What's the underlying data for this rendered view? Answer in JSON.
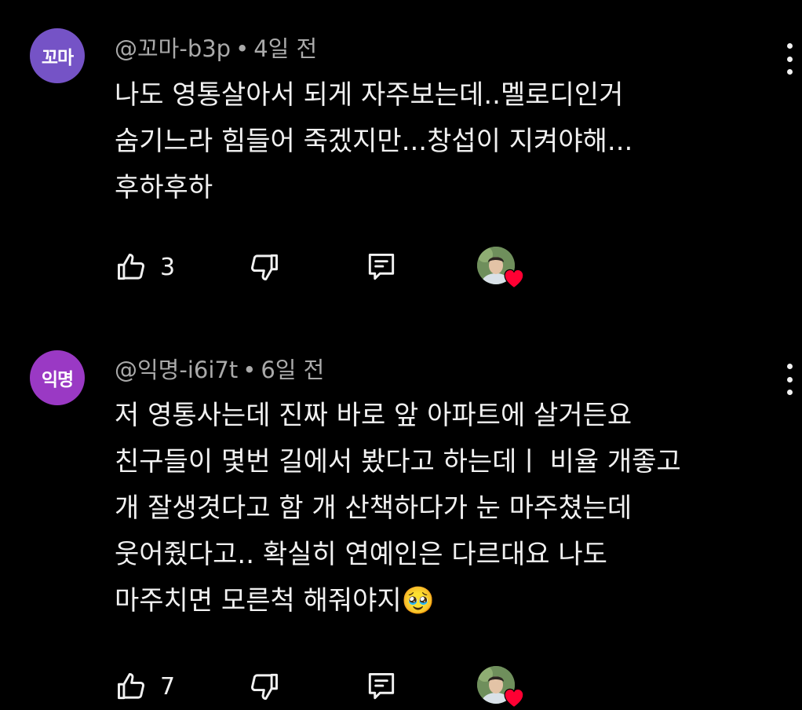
{
  "colors": {
    "background": "#000000",
    "text": "#f1f1f1",
    "meta": "#aaaaaa",
    "avatar1": "#7553c6",
    "avatar2": "#9a39c4",
    "heart": "#ff0033"
  },
  "comments": [
    {
      "avatar_text": "꼬마",
      "handle": "@꼬마-b3p",
      "separator": "•",
      "time": "4일 전",
      "lines": [
        "나도 영통살아서 되게 자주보는데..멜로디인거",
        "숨기느라 힘들어 죽겠지만...창섭이 지켜야해...",
        "후하후하"
      ],
      "like_count": "3",
      "icons": [
        "like-icon",
        "dislike-icon",
        "reply-icon",
        "creator-heart-icon",
        "more-options-icon"
      ]
    },
    {
      "avatar_text": "익명",
      "handle": "@익명-i6i7t",
      "separator": "•",
      "time": "6일 전",
      "lines": [
        "저 영통사는데 진짜 바로 앞 아파트에 살거든요",
        "친구들이 몇번 길에서 봤다고 하는데ㅣ 비율 개좋고",
        "개 잘생겻다고 함 개 산책하다가 눈 마주쳤는데",
        "웃어줬다고.. 확실히 연예인은 다르대요 나도",
        "마주치면 모른척 해줘야지🥹"
      ],
      "like_count": "7",
      "icons": [
        "like-icon",
        "dislike-icon",
        "reply-icon",
        "creator-heart-icon",
        "more-options-icon"
      ]
    }
  ]
}
